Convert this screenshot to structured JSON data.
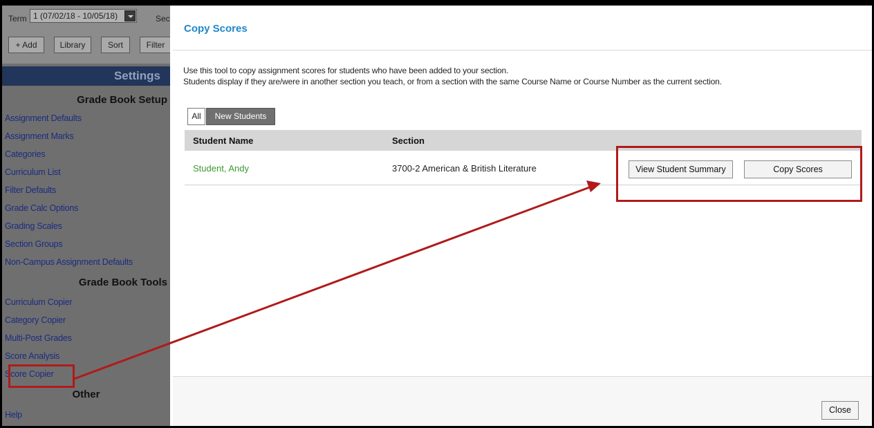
{
  "left_panel": {
    "term_label": "Term",
    "term_value": "1 (07/02/18 - 10/05/18)",
    "section_label": "Sect",
    "toolbar": {
      "add": "+ Add",
      "library": "Library",
      "sort": "Sort",
      "filter": "Filter"
    },
    "settings_title": "Settings",
    "setup_heading": "Grade Book Setup",
    "setup_links": [
      "Assignment Defaults",
      "Assignment Marks",
      "Categories",
      "Curriculum List",
      "Filter Defaults",
      "Grade Calc Options",
      "Grading Scales",
      "Section Groups",
      "Non-Campus Assignment Defaults"
    ],
    "tools_heading": "Grade Book Tools",
    "tools_links": [
      "Curriculum Copier",
      "Category Copier",
      "Multi-Post Grades",
      "Score Analysis",
      "Score Copier"
    ],
    "other_heading": "Other",
    "other_links": [
      "Help"
    ]
  },
  "modal": {
    "title": "Copy Scores",
    "description_line1": "Use this tool to copy assignment scores for students who have been added to your section.",
    "description_line2": "Students display if they are/were in another section you teach, or from a section with the same Course Name or Course Number as the current section.",
    "filters": {
      "all": "All",
      "new_students": "New Students",
      "selected": "New Students"
    },
    "columns": {
      "student_name": "Student Name",
      "section": "Section"
    },
    "rows": [
      {
        "student": "Student, Andy",
        "section": "3700-2 American & British Literature",
        "view_summary": "View Student Summary",
        "copy_scores": "Copy Scores"
      }
    ],
    "close_label": "Close"
  },
  "colors": {
    "title_blue": "#1f86c9",
    "student_green": "#3a9a2f",
    "highlight_red": "#b01a1a",
    "settings_bar": "#22355a"
  }
}
